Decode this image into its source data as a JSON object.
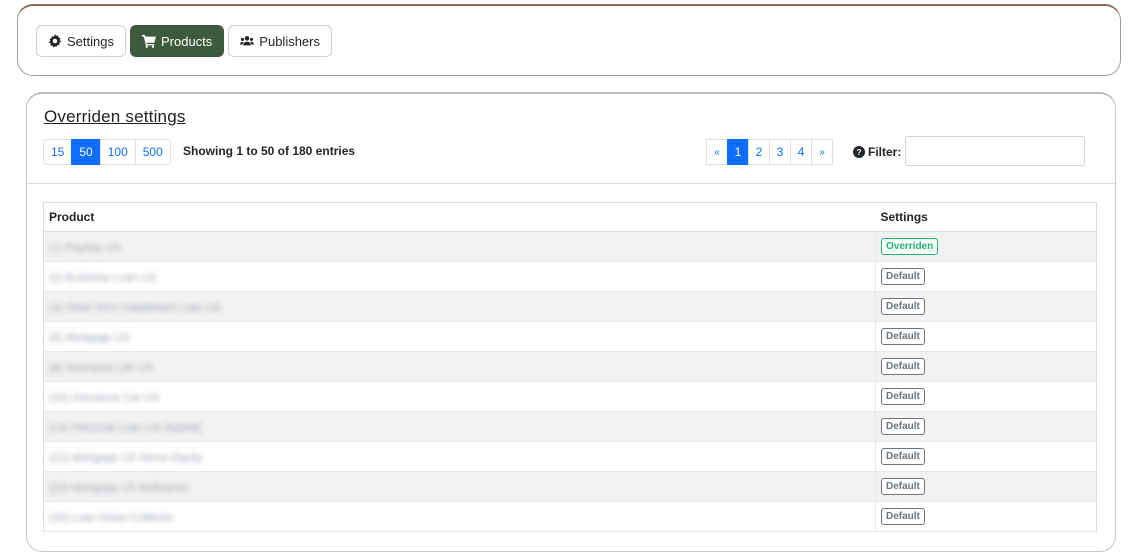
{
  "tabs": [
    {
      "label": "Settings",
      "icon": "gear-icon",
      "active": false
    },
    {
      "label": "Products",
      "icon": "cart-icon",
      "active": true
    },
    {
      "label": "Publishers",
      "icon": "users-icon",
      "active": false
    }
  ],
  "panel": {
    "title": "Overriden settings",
    "page_sizes": [
      "15",
      "50",
      "100",
      "500"
    ],
    "active_page_size": "50",
    "showing": "Showing 1 to 50 of 180 entries",
    "pager": {
      "prev": "«",
      "pages": [
        "1",
        "2",
        "3",
        "4"
      ],
      "active": "1",
      "next": "»"
    },
    "filter_label": "Filter:",
    "filter_value": ""
  },
  "table": {
    "headers": {
      "product": "Product",
      "settings": "Settings"
    },
    "rows": [
      {
        "product": "(1) Payday US",
        "setting": "Overriden"
      },
      {
        "product": "(2) Business Loan US",
        "setting": "Default"
      },
      {
        "product": "(4) Short Term Installment Loan US",
        "setting": "Default"
      },
      {
        "product": "(6) Mortgage US",
        "setting": "Default"
      },
      {
        "product": "(8) Insurance Life US",
        "setting": "Default"
      },
      {
        "product": "(10) Insurance Car US",
        "setting": "Default"
      },
      {
        "product": "(14) Personal Loan US (hybrid)",
        "setting": "Default"
      },
      {
        "product": "(22) Mortgage US Home Equity",
        "setting": "Default"
      },
      {
        "product": "(23) Mortgage US Refinance",
        "setting": "Default"
      },
      {
        "product": "(30) Loan Glass Collector",
        "setting": "Default"
      }
    ]
  },
  "colors": {
    "accent": "#0d6efd",
    "active_tab": "#3d5a3e",
    "overriden": "#20b26b",
    "default": "#6c757d"
  }
}
